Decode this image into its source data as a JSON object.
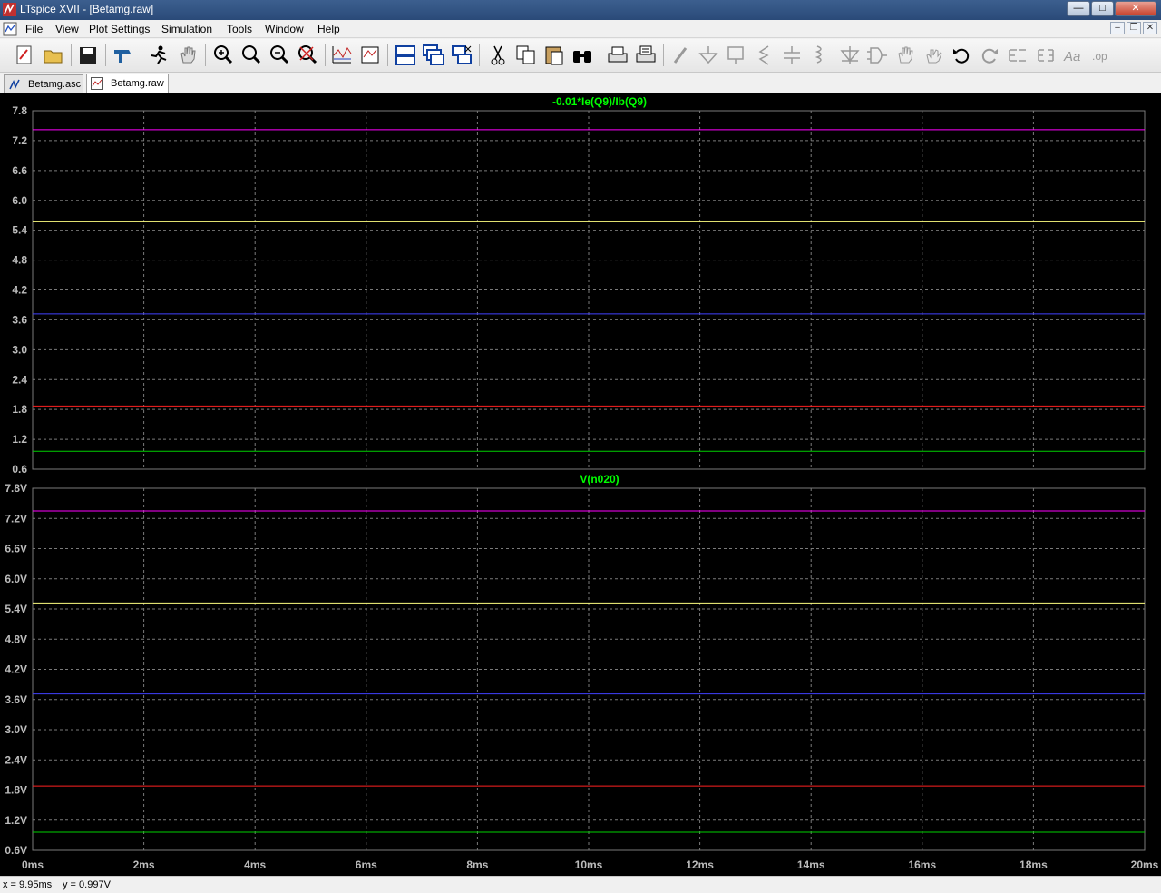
{
  "window": {
    "title": "LTspice XVII - [Betamg.raw]",
    "min_symbol": "—",
    "max_symbol": "□",
    "close_symbol": "✕"
  },
  "menu": [
    "File",
    "View",
    "Plot Settings",
    "Simulation",
    "Tools",
    "Window",
    "Help"
  ],
  "mdi_controls": [
    "–",
    "❐",
    "✕"
  ],
  "toolbar_icons": [
    "new-schematic-icon",
    "open-icon",
    "save-icon",
    "control-panel-icon",
    "run-icon",
    "pan-hand-icon",
    "zoom-in-icon",
    "zoom-fit-icon",
    "zoom-out-icon",
    "zoom-cancel-icon",
    "autorange-icon",
    "pick-traces-icon",
    "tile-horizontal-icon",
    "cascade-icon",
    "close-all-icon",
    "cut-icon",
    "copy-icon",
    "paste-icon",
    "find-icon",
    "print-icon",
    "print-preview-icon",
    "wire-icon",
    "ground-icon",
    "label-net-icon",
    "resistor-icon",
    "capacitor-icon",
    "inductor-icon",
    "diode-icon",
    "component-icon",
    "move-icon",
    "drag-icon",
    "undo-icon",
    "redo-icon",
    "rotate-icon",
    "mirror-icon",
    "text-icon",
    "spice-directive-icon"
  ],
  "tabs": [
    {
      "label": "Betamg.asc",
      "icon": "schematic-icon",
      "active": false
    },
    {
      "label": "Betamg.raw",
      "icon": "waveform-icon",
      "active": true
    }
  ],
  "colors": {
    "background": "#000000",
    "grid": "#7a7a7a",
    "axis_text": "#bdbdbd",
    "title_text": "#00ff00",
    "series": [
      "#ff00ff",
      "#ffff80",
      "#4040ff",
      "#ff2020",
      "#00d000"
    ]
  },
  "chart_data": [
    {
      "type": "line",
      "title": "-0.01*Ie(Q9)/Ib(Q9)",
      "xlim": [
        0,
        20
      ],
      "ylim": [
        0.6,
        7.8
      ],
      "yticks": [
        "7.8",
        "7.2",
        "6.6",
        "6.0",
        "5.4",
        "4.8",
        "4.2",
        "3.6",
        "3.0",
        "2.4",
        "1.8",
        "1.2",
        "0.6"
      ],
      "grid": true,
      "series": [
        {
          "color": "#ff00ff",
          "values": [
            7.42,
            7.42
          ]
        },
        {
          "color": "#ffff80",
          "values": [
            5.57,
            5.57
          ]
        },
        {
          "color": "#4040ff",
          "values": [
            3.72,
            3.72
          ]
        },
        {
          "color": "#ff2020",
          "values": [
            1.87,
            1.87
          ]
        },
        {
          "color": "#00d000",
          "values": [
            0.96,
            0.96
          ]
        }
      ]
    },
    {
      "type": "line",
      "title": "V(n020)",
      "xlim": [
        0,
        20
      ],
      "ylim": [
        0.6,
        7.8
      ],
      "yticks": [
        "7.8V",
        "7.2V",
        "6.6V",
        "6.0V",
        "5.4V",
        "4.8V",
        "4.2V",
        "3.6V",
        "3.0V",
        "2.4V",
        "1.8V",
        "1.2V",
        "0.6V"
      ],
      "xticks": [
        "0ms",
        "2ms",
        "4ms",
        "6ms",
        "8ms",
        "10ms",
        "12ms",
        "14ms",
        "16ms",
        "18ms",
        "20ms"
      ],
      "grid": true,
      "series": [
        {
          "color": "#ff00ff",
          "values": [
            7.35,
            7.35
          ]
        },
        {
          "color": "#ffff80",
          "values": [
            5.52,
            5.52
          ]
        },
        {
          "color": "#4040ff",
          "values": [
            3.71,
            3.71
          ]
        },
        {
          "color": "#ff2020",
          "values": [
            1.88,
            1.88
          ]
        },
        {
          "color": "#00d000",
          "values": [
            0.96,
            0.96
          ]
        }
      ]
    }
  ],
  "status": {
    "x_readout": "x = 9.95ms",
    "y_readout": "y = 0.997V"
  }
}
